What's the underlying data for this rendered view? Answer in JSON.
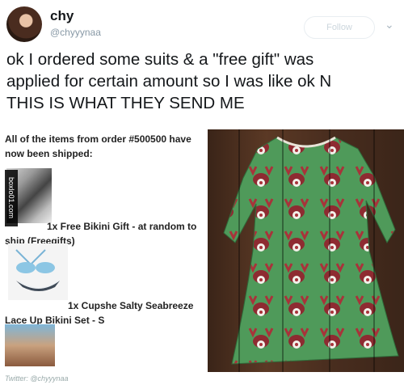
{
  "author": {
    "name": "chy",
    "handle": "@chyyynaa",
    "follow_label": "Follow"
  },
  "tweet": {
    "lines": [
      "ok I ordered some suits & a \"free gift\" was",
      "applied for certain amount so I was like ok N",
      "THIS IS WHAT THEY SEND ME"
    ]
  },
  "email": {
    "header_lines": [
      "All of the items from order #500500 have",
      "now been shipped:"
    ],
    "item1": "1x Free Bikini Gift - at random to",
    "item1_cont": "ship (Freegifts)",
    "item2": "1x Cupshe Salty Seabreeze",
    "item2_cont": "Lace Up Bikini Set - S",
    "credit": "Twitter: @chyyynaa",
    "watermark": "boxlo01.com"
  },
  "icons": {
    "menu": "chevron-down-icon"
  },
  "colors": {
    "dress_green": "#4f9a5a",
    "floor_brown": "#4a2e1f",
    "reindeer_red": "#a8333a"
  }
}
